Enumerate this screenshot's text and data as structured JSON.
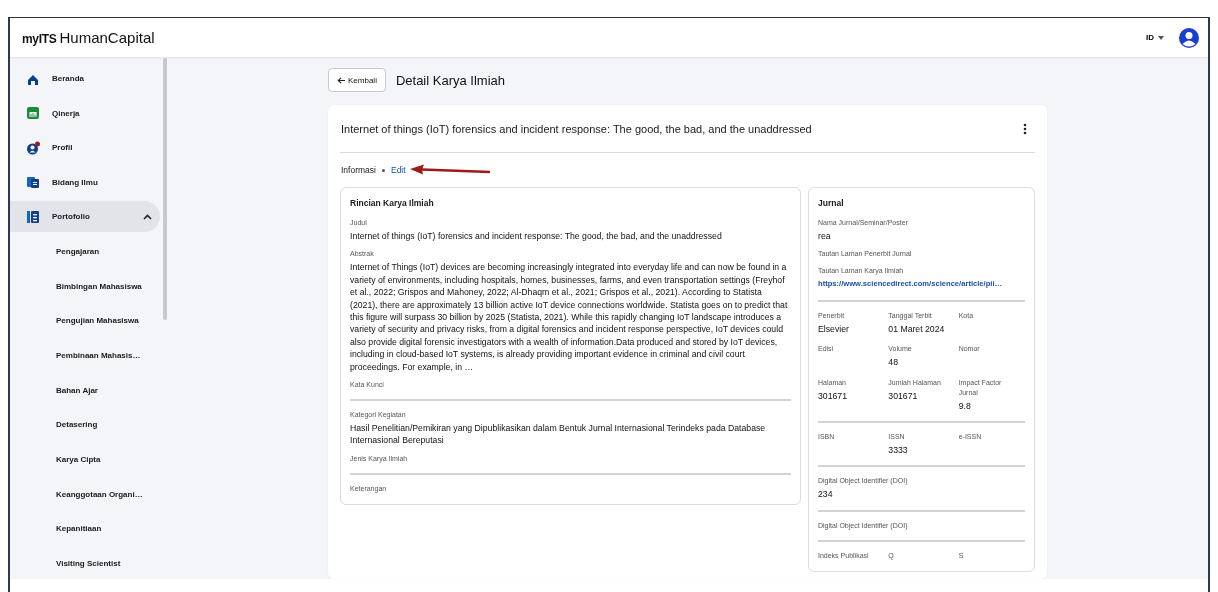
{
  "header": {
    "logo_prefix": "myITS",
    "logo_name": "HumanCapital",
    "language": "ID"
  },
  "sidebar": {
    "items": [
      {
        "kind": "home",
        "label": "Beranda",
        "selected": false
      },
      {
        "kind": "sheet",
        "label": "Qinerja",
        "selected": false
      },
      {
        "kind": "user",
        "label": "Profil",
        "selected": false,
        "notification": true
      },
      {
        "kind": "book",
        "label": "Bidang Ilmu",
        "selected": false
      },
      {
        "kind": "list",
        "label": "Portofolio",
        "selected": true,
        "expanded": true,
        "children": [
          {
            "label": "Pengajaran",
            "selected": false
          },
          {
            "label": "Bimbingan Mahasiswa",
            "selected": false
          },
          {
            "label": "Pengujian Mahasiswa",
            "selected": false
          },
          {
            "label": "Pembinaan Mahasis…",
            "selected": false
          },
          {
            "label": "Bahan Ajar",
            "selected": false
          },
          {
            "label": "Detasering",
            "selected": false
          },
          {
            "label": "Karya Cipta",
            "selected": false
          },
          {
            "label": "Keanggotaan Organi…",
            "selected": false
          },
          {
            "label": "Kepanitiaan",
            "selected": false
          },
          {
            "label": "Visiting Scientist",
            "selected": false
          }
        ]
      }
    ]
  },
  "back_button": "Kembali",
  "page_title": "Detail Karya Ilmiah",
  "card": {
    "title": "Internet of things (IoT) forensics and incident response: The good, the bad, and the unaddressed",
    "section_label": "Informasi",
    "edit_link": "Edit",
    "details": {
      "title": "Rincian Karya Ilmiah",
      "sections": [
        {
          "kind": "stack",
          "fields": [
            {
              "label": "Judul",
              "value": "Internet of things (IoT) forensics and incident response: The good, the bad, and the unaddressed"
            },
            {
              "label": "Abstrak",
              "value": "Internet of Things (IoT) devices are becoming increasingly integrated into everyday life and can now be found in a variety of environments, including hospitals, homes, businesses, farms, and even transportation settings (Freyhof et al., 2022; Grispos and Mahoney, 2022; Al-Dhaqm et al., 2021; Grispos et al., 2021). According to Statista (2021), there are approximately 13 billion active IoT device connections worldwide. Statista goes on to predict that this figure will surpass 30 billion by 2025 (Statista, 2021). While this rapidly changing IoT landscape introduces a variety of security and privacy risks, from a digital forensics and incident response perspective, IoT devices could also provide digital forensic investigators with a wealth of information.Data produced and stored by IoT devices, including in cloud-based IoT systems, is already providing important evidence in criminal and civil court proceedings. For example, in …"
            },
            {
              "label": "Kata Kunci"
            }
          ]
        },
        {
          "kind": "stack",
          "fields": [
            {
              "label": "Kategori Kegiatan",
              "value": "Hasil Penelitian/Pemikiran yang Dipublikasikan dalam Bentuk Jurnal Internasional Terindeks pada Database Internasional Bereputasi"
            },
            {
              "label": "Jenis Karya Ilmiah"
            }
          ]
        },
        {
          "kind": "stack",
          "fields": [
            {
              "label": "Keterangan"
            }
          ]
        }
      ]
    },
    "journal": {
      "title": "Jurnal",
      "sections": [
        {
          "kind": "stack",
          "fields": [
            {
              "label": "Nama Jurnal/Seminar/Poster",
              "value": "rea"
            },
            {
              "label": "Tautan Laman Penerbit Jurnal"
            },
            {
              "label": "Tautan Laman Karya Ilmiah",
              "value": "https://www.sciencedirect.com/science/article/pii…",
              "kind": "link"
            }
          ]
        },
        {
          "kind": "grid",
          "fields": [
            {
              "label": "Penerbit",
              "value": "Elsevier"
            },
            {
              "label": "Tanggal Terbit",
              "value": "01 Maret 2024"
            },
            {
              "label": "Kota"
            },
            {
              "label": "Edisi"
            },
            {
              "label": "Volume",
              "value": "48"
            },
            {
              "label": "Nomor"
            },
            {
              "label": "Halaman",
              "value": "301671"
            },
            {
              "label": "Jumlah Halaman",
              "value": "301671"
            },
            {
              "label": "Impact Factor Jurnal",
              "value": "9.8"
            }
          ]
        },
        {
          "kind": "grid",
          "fields": [
            {
              "label": "ISBN"
            },
            {
              "label": "ISSN",
              "value": "3333"
            },
            {
              "label": "e-ISSN"
            }
          ]
        },
        {
          "kind": "stack",
          "fields": [
            {
              "label": "Digital Object Identifier (DOI)",
              "value": "234"
            }
          ]
        },
        {
          "kind": "stack",
          "fields": [
            {
              "label": "Digital Object Identifier (DOI)"
            }
          ]
        },
        {
          "kind": "grid",
          "fields": [
            {
              "label": "Indeks Publikasi"
            },
            {
              "label": "Q"
            },
            {
              "label": "S"
            }
          ]
        }
      ]
    }
  }
}
